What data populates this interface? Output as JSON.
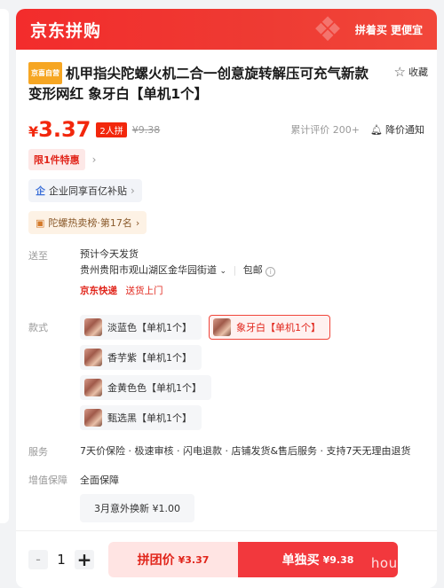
{
  "banner": {
    "logo": "京东拼购",
    "slogan": "拼着买 更便宜"
  },
  "product": {
    "self_tag": "京喜自营",
    "title": "机甲指尖陀螺火机二合一创意旋转解压可充气新款变形网红 象牙白【单机1个】",
    "fav_label": "收藏"
  },
  "price": {
    "currency": "¥",
    "value": "3.37",
    "group_badge": "2人拼",
    "original": "¥9.38",
    "reviews": "累计评价 200+",
    "notify": "降价通知"
  },
  "promo": {
    "limit": "限1件特惠"
  },
  "pills": {
    "enterprise": "企业同享百亿补贴",
    "hotlist": "陀螺热卖榜·第17名"
  },
  "shipping": {
    "label": "送至",
    "eta": "预计今天发货",
    "address": "贵州贵阳市观山湖区金华园街道",
    "free_ship": "包邮",
    "express": "京东快递",
    "door": "送货上门"
  },
  "styles": {
    "label": "款式",
    "options": [
      {
        "name": "淡蓝色【单机1个】",
        "selected": false
      },
      {
        "name": "象牙白【单机1个】",
        "selected": true
      },
      {
        "name": "香芋紫【单机1个】",
        "selected": false
      },
      {
        "name": "金黄色色【单机1个】",
        "selected": false
      },
      {
        "name": "甄选黑【单机1个】",
        "selected": false
      }
    ]
  },
  "service": {
    "label": "服务",
    "text": "7天价保险 · 极速审核 · 闪电退款 · 店铺发货&售后服务 · 支持7天无理由退货"
  },
  "vas": {
    "label": "增值保障",
    "title": "全面保障",
    "option": "3月意外换新  ¥1.00"
  },
  "bottom": {
    "qty_minus": "-",
    "qty": "1",
    "qty_plus": "+",
    "group_buy_label": "拼团价",
    "group_buy_price": "¥3.37",
    "solo_buy_label": "单独买",
    "solo_buy_price": "¥9.38"
  },
  "watermark": "houston",
  "colors": {
    "brand_red": "#f2270c",
    "banner_red": "#f32c2c",
    "solo_button": "#f2383d",
    "group_button_bg": "#ffe4e3"
  }
}
